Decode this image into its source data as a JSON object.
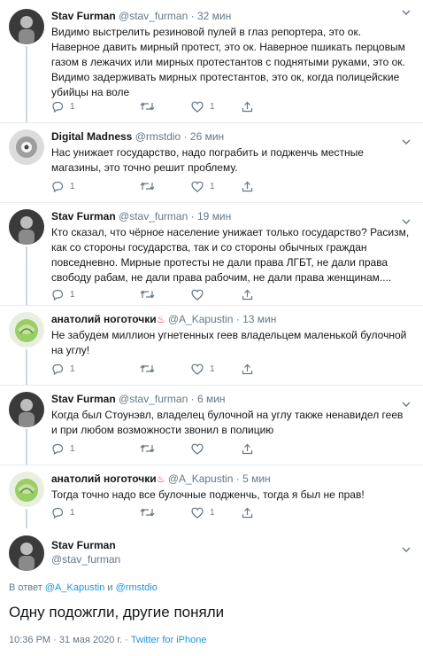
{
  "tweets": [
    {
      "name": "Stav Furman",
      "handle": "@stav_furman",
      "separator": "·",
      "time": "32 мин",
      "text": "Видимо выстрелить резиновой пулей в глаз репортера, это ок. Наверное давить мирный протест, это ок. Наверное пшикать перцовым газом в лежачих или мирных протестантов с поднятыми руками, это ок. Видимо задерживать мирных протестантов, это ок, когда полицейские убийцы на воле",
      "replies": "1",
      "retweets": "",
      "likes": "1"
    },
    {
      "name": "Digital Madness",
      "handle": "@rmstdio",
      "separator": "·",
      "time": "26 мин",
      "text": "Нас унижает государство, надо пограбить и подженчь местные магазины, это точно решит проблему.",
      "replies": "1",
      "retweets": "",
      "likes": "1"
    },
    {
      "name": "Stav Furman",
      "handle": "@stav_furman",
      "separator": "·",
      "time": "19 мин",
      "text": "Кто сказал, что чёрное население унижает только государство? Расизм, как со стороны государства, так и со стороны обычных граждан повседневно. Мирные протесты не дали права ЛГБТ, не дали права свободу рабам, не дали права рабочим, не дали права женщинам....",
      "replies": "1",
      "retweets": "",
      "likes": ""
    },
    {
      "name": "анатолий ноготочки",
      "handle": "@A_Kapustin",
      "separator": "·",
      "time": "13 мин",
      "text": "Не забудем миллион угнетенных геев владельцем маленькой булочной на углу!",
      "replies": "1",
      "retweets": "",
      "likes": "1"
    },
    {
      "name": "Stav Furman",
      "handle": "@stav_furman",
      "separator": "·",
      "time": "6 мин",
      "text": "Когда был Стоунэвл, владелец булочной на углу также ненавидел геев и при любом возможности звонил в полицию",
      "replies": "1",
      "retweets": "",
      "likes": ""
    },
    {
      "name": "анатолий ноготочки",
      "handle": "@A_Kapustin",
      "separator": "·",
      "time": "5 мин",
      "text": "Тогда точно надо все булочные подженчь, тогда я был не прав!",
      "replies": "1",
      "retweets": "",
      "likes": "1"
    }
  ],
  "main": {
    "name": "Stav Furman",
    "handle": "@stav_furman",
    "reply_prefix": "В ответ",
    "reply_user1": "@A_Kapustin",
    "reply_and": "и",
    "reply_user2": "@rmstdio",
    "text": "Одну подожгли, другие поняли",
    "datetime": "10:36 PM · 31 мая 2020 г. ·",
    "source": "Twitter for iPhone"
  },
  "colors": {
    "accent": "#1b95e0",
    "muted": "#657786",
    "text": "#14171a",
    "divider": "#e6ecf0",
    "emoji": "#e0245e"
  },
  "icons": [
    "reply-icon",
    "retweet-icon",
    "like-icon",
    "share-icon",
    "chevron-down-icon",
    "fire-emoji-icon"
  ]
}
